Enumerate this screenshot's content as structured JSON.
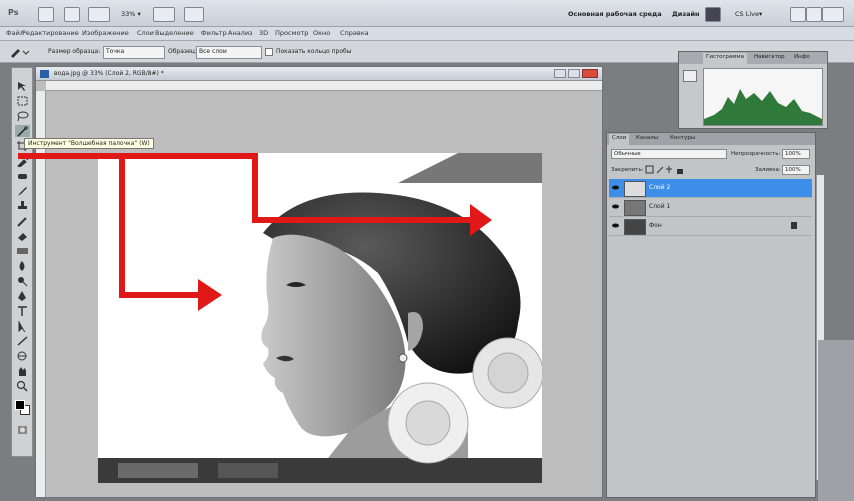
{
  "app_bar": {
    "ps_logo": "Ps",
    "zoom_value": "33% ▾",
    "workspace_label": "Основная рабочая среда",
    "design_label": "Дизайн",
    "cs_live": "CS Live▾"
  },
  "menu": {
    "items": [
      "Файл",
      "Редактирование",
      "Изображение",
      "Слои",
      "Выделение",
      "Фильтр",
      "Анализ",
      "3D",
      "Просмотр",
      "Окно",
      "Справка"
    ]
  },
  "options": {
    "sample_label": "Размер образца:",
    "sample_value": "Точка",
    "sample_from_label": "Образец:",
    "sample_from_value": "Все слои",
    "show_ring": "Показать кольцо пробы"
  },
  "document": {
    "title": "вода.jpg @ 33% (Слой 2, RGB/8#) *"
  },
  "tooltip": "Инструмент \"Волшебная палочка\" (W)",
  "histogram": {
    "tab1": "Гистограмма",
    "tab2": "Навигатор",
    "tab3": "Инфо"
  },
  "layers_panel": {
    "tabs": [
      "Слои",
      "Каналы",
      "Контуры"
    ],
    "blend_mode": "Обычные",
    "opacity_label": "Непрозрачность:",
    "opacity_value": "100%",
    "lock_label": "Закрепить:",
    "fill_label": "Заливка:",
    "fill_value": "100%",
    "layers": [
      "Слой 2",
      "Слой 1",
      "Фон"
    ]
  },
  "colors": {
    "arrow_red": "#e01818",
    "selected_layer": "#3d8ee8",
    "histogram_green": "#2f7a3a"
  }
}
